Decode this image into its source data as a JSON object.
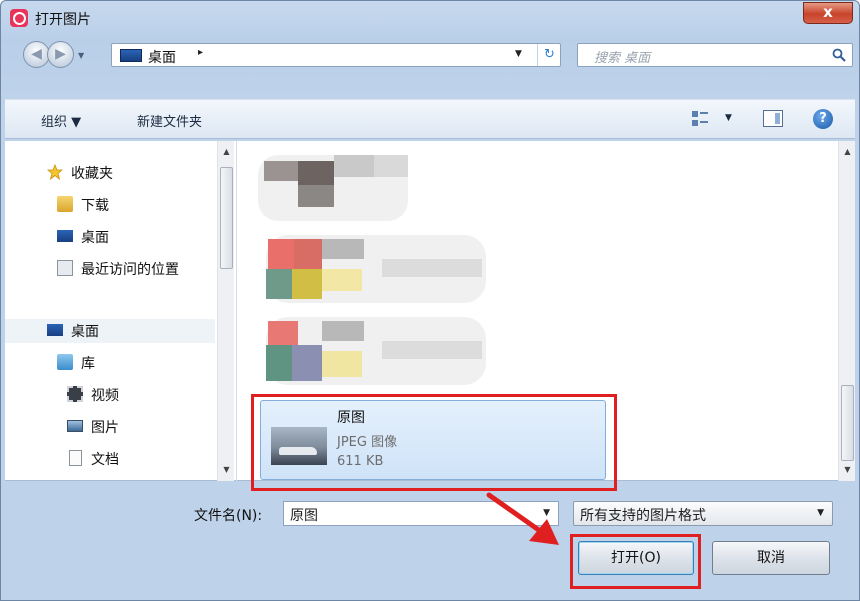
{
  "window": {
    "title": "打开图片",
    "close_glyph": "x"
  },
  "address": {
    "location": "桌面",
    "separator": "▸",
    "search_placeholder": "搜索 桌面"
  },
  "toolbar": {
    "organize": "组织 ▼",
    "new_folder": "新建文件夹",
    "help": "?"
  },
  "nav": {
    "items": [
      {
        "label": "收藏夹",
        "icon": "star-icon"
      },
      {
        "label": "下载",
        "icon": "download-folder-icon"
      },
      {
        "label": "桌面",
        "icon": "desktop-icon"
      },
      {
        "label": "最近访问的位置",
        "icon": "recent-places-icon"
      },
      {
        "label": "桌面",
        "icon": "desktop-icon"
      },
      {
        "label": "库",
        "icon": "library-icon"
      },
      {
        "label": "视频",
        "icon": "video-icon"
      },
      {
        "label": "图片",
        "icon": "pictures-icon"
      },
      {
        "label": "文档",
        "icon": "document-icon"
      }
    ]
  },
  "selected_file": {
    "name": "原图",
    "type": "JPEG 图像",
    "size": "611 KB"
  },
  "footer": {
    "filename_label": "文件名(N):",
    "filename_value": "原图",
    "filetype_value": "所有支持的图片格式",
    "open_button": "打开(O)",
    "cancel_button": "取消"
  },
  "colors": {
    "highlight_box": "#e02020",
    "selection_fill": "#cfe3f8"
  }
}
